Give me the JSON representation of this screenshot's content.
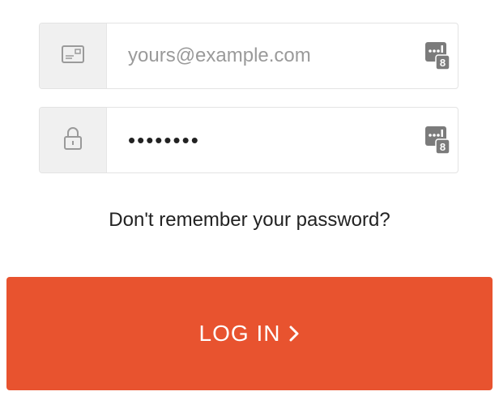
{
  "email_field": {
    "value": "",
    "placeholder": "yours@example.com",
    "icon": "email-card-icon"
  },
  "password_field": {
    "value": "••••••••",
    "icon": "lock-icon"
  },
  "password_manager": {
    "icon": "password-manager-icon",
    "badge": "8"
  },
  "forgot_link": "Don't remember your password?",
  "login_button": {
    "label": "LOG IN",
    "icon": "chevron-right-icon",
    "color": "#e8532f"
  }
}
